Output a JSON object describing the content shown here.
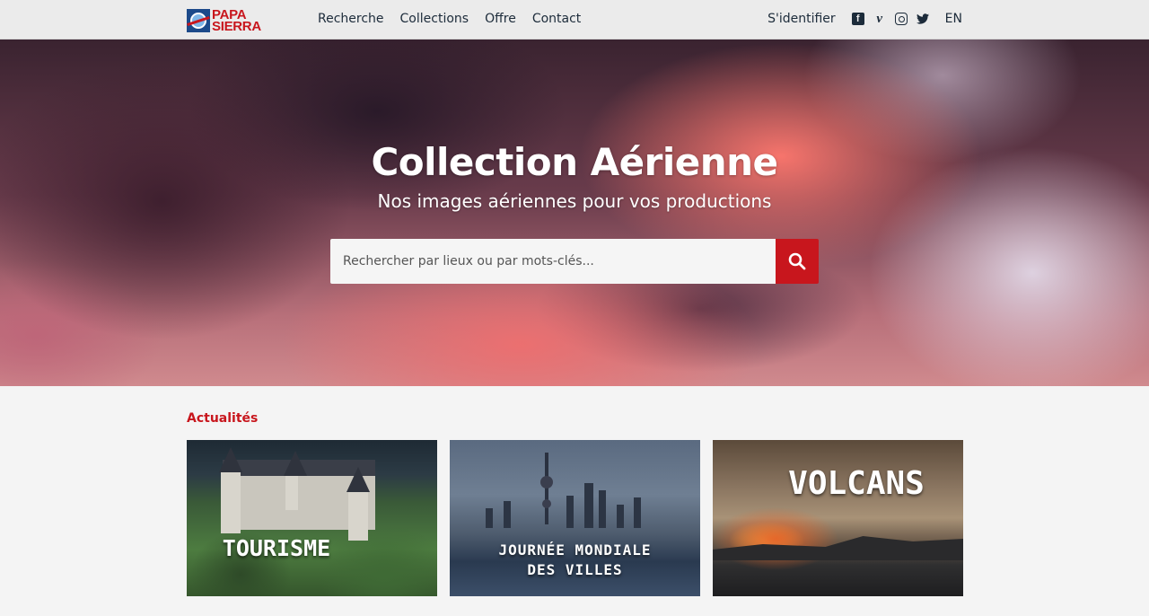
{
  "brand": {
    "line1": "PAPA",
    "line2": "SIERRA",
    "accent": "#c8161d"
  },
  "nav": {
    "items": [
      "Recherche",
      "Collections",
      "Offre",
      "Contact"
    ]
  },
  "right_nav": {
    "login": "S'identifier",
    "social_icons": [
      "facebook-icon",
      "vimeo-icon",
      "instagram-icon",
      "twitter-icon"
    ],
    "language": "EN"
  },
  "hero": {
    "title": "Collection Aérienne",
    "subtitle": "Nos images aériennes pour vos productions",
    "search_placeholder": "Rechercher par lieux ou par mots-clés..."
  },
  "news": {
    "title": "Actualités",
    "cards": [
      {
        "label": "TOURISME"
      },
      {
        "label_line1": "JOURNÉE MONDIALE",
        "label_line2": "DES VILLES"
      },
      {
        "label": "VOLCANS"
      }
    ]
  }
}
